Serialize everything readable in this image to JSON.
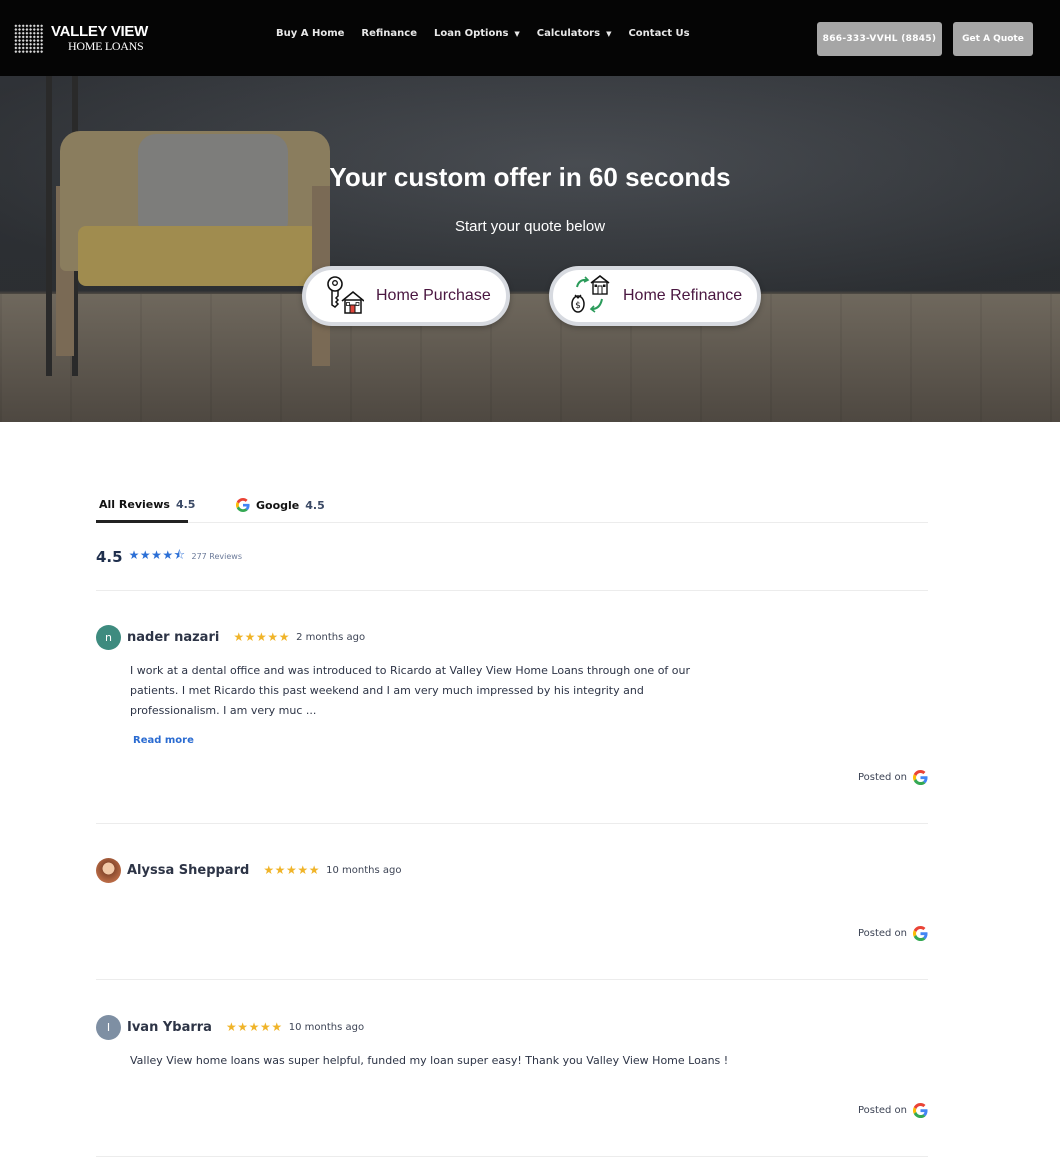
{
  "header": {
    "logo_line1": "VALLEY VIEW",
    "logo_line2": "HOME LOANS",
    "nav": [
      {
        "label": "Buy A Home"
      },
      {
        "label": "Refinance"
      },
      {
        "label": "Loan Options"
      },
      {
        "label": "Calculators"
      },
      {
        "label": "Contact Us"
      }
    ],
    "phone_button": "866-333-VVHL (8845)",
    "quote_button": "Get A Quote"
  },
  "hero": {
    "title": "Your custom offer in 60 seconds",
    "subtitle": "Start your quote below",
    "purchase_label": "Home Purchase",
    "refinance_label": "Home Refinance"
  },
  "reviews": {
    "tabs": {
      "all_label": "All Reviews",
      "all_score": "4.5",
      "google_label": "Google",
      "google_score": "4.5"
    },
    "summary": {
      "rating": "4.5",
      "stars": "★★★★⯪",
      "count": "277 Reviews"
    },
    "posted_on_label": "Posted on",
    "read_more_label": "Read more",
    "items": [
      {
        "initial": "n",
        "name": "nader nazari",
        "stars": "★★★★★",
        "time": "2 months ago",
        "text": "I work at a dental office and was introduced to Ricardo at Valley View Home Loans through one of our patients. I met Ricardo this past weekend and I am very much impressed by his integrity and professionalism. I am very muc ..."
      },
      {
        "initial": "",
        "name": "Alyssa Sheppard",
        "stars": "★★★★★",
        "time": "10 months ago",
        "text": ""
      },
      {
        "initial": "I",
        "name": "Ivan Ybarra",
        "stars": "★★★★★",
        "time": "10 months ago",
        "text": "Valley View home loans was super helpful, funded my loan super easy! Thank you Valley View Home Loans !"
      }
    ]
  },
  "colors": {
    "header_bg": "#050505",
    "button_gray": "#a6a6a6",
    "hero_label": "#4a1741",
    "star_blue": "#2b6fd6",
    "star_gold": "#f0b429",
    "link_blue": "#2a6bd1",
    "avatar_teal": "#3e8b7f",
    "avatar_gray": "#7e8fa3"
  },
  "icons": [
    "hamburger-grid-logo",
    "caret-down-icon",
    "key-house-icon",
    "money-exchange-house-icon",
    "google-icon",
    "star-icon"
  ]
}
